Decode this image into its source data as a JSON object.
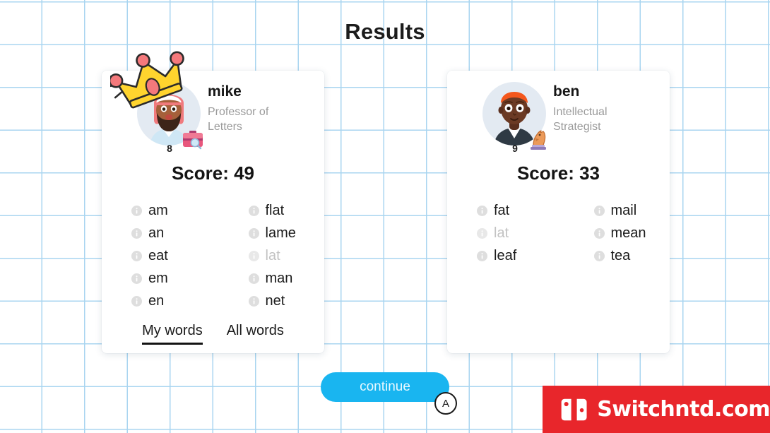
{
  "page": {
    "title": "Results"
  },
  "players": [
    {
      "name": "mike",
      "role": "Professor of Letters",
      "role_line1": "Professor of",
      "role_line2": "Letters",
      "level": "8",
      "role_icon": "briefcase-icon",
      "crown": true,
      "score_label": "Score: 49",
      "score": 49,
      "words_left": [
        {
          "text": "am",
          "found": true
        },
        {
          "text": "an",
          "found": true
        },
        {
          "text": "eat",
          "found": true
        },
        {
          "text": "em",
          "found": true
        },
        {
          "text": "en",
          "found": true
        }
      ],
      "words_right": [
        {
          "text": "flat",
          "found": true
        },
        {
          "text": "lame",
          "found": true
        },
        {
          "text": "lat",
          "found": false
        },
        {
          "text": "man",
          "found": true
        },
        {
          "text": "net",
          "found": true
        }
      ],
      "tabs": [
        {
          "label": "My words",
          "active": true
        },
        {
          "label": "All words",
          "active": false
        }
      ]
    },
    {
      "name": "ben",
      "role": "Intellectual Strategist",
      "role_line1": "Intellectual",
      "role_line2": "Strategist",
      "level": "9",
      "role_icon": "chess-knight-icon",
      "crown": false,
      "score_label": "Score: 33",
      "score": 33,
      "words_left": [
        {
          "text": "fat",
          "found": true
        },
        {
          "text": "lat",
          "found": false
        },
        {
          "text": "leaf",
          "found": true
        }
      ],
      "words_right": [
        {
          "text": "mail",
          "found": true
        },
        {
          "text": "mean",
          "found": true
        },
        {
          "text": "tea",
          "found": true
        }
      ],
      "tabs": []
    }
  ],
  "footer": {
    "continue_label": "continue",
    "a_button_label": "A"
  },
  "watermark": {
    "text": "Switchntd.com",
    "logo": "nintendo-switch-logo",
    "color": "#e8262b"
  },
  "theme": {
    "grid_line": "#a9d5f0",
    "accent": "#19b5f0",
    "text": "#1c1c1c",
    "muted": "#9a9a9a",
    "dim_word": "#c2c2c2"
  }
}
